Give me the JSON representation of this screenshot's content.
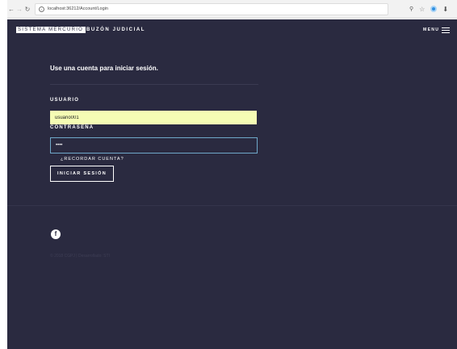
{
  "browser": {
    "url": "localhost:36212/Account/Login"
  },
  "header": {
    "brand": "SISTEMA MERCURIO",
    "subtitle": "BUZÓN JUDICIAL",
    "menu_label": "MENU"
  },
  "login": {
    "heading": "Use una cuenta para iniciar sesión.",
    "username_label": "USUARIO",
    "username_value": "usuario001",
    "password_label": "CONTRASEÑA",
    "password_value": "••••",
    "remember_label": "¿RECORDAR CUENTA?",
    "submit_label": "INICIAR SESIÓN"
  },
  "footer": {
    "social_icon": "f",
    "copyright": "© 2018 CGPJ | Desarrollado: STI"
  },
  "colors": {
    "background": "#2a2a40",
    "username_fill": "#f5fcb4",
    "focus_border": "#6fa8c9"
  }
}
